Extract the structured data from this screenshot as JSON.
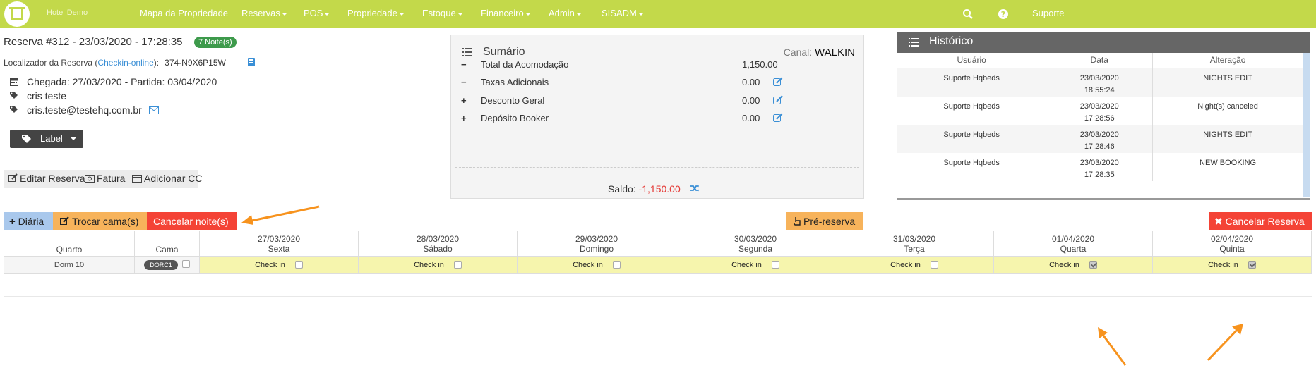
{
  "nav": {
    "brand": "Hotel Demo",
    "items": [
      "Mapa da Propriedade",
      "Reservas",
      "POS",
      "Propriedade",
      "Estoque",
      "Financeiro",
      "Admin",
      "SISADM"
    ],
    "support": "Suporte",
    "accent": "#c3d94a"
  },
  "reservation": {
    "title": "Reserva #312 - 23/03/2020 - 17:28:35",
    "nights_badge": "7 Noite(s)",
    "locator_prefix": "Localizador da Reserva (",
    "locator_link": "Checkin-online",
    "locator_suffix": "):",
    "locator_code": "374-N9X6P15W",
    "dates": "Chegada: 27/03/2020  -  Partida: 03/04/2020",
    "guest": "cris teste",
    "email": "cris.teste@testehq.com.br",
    "label_button": "Label"
  },
  "actions": {
    "edit": "Editar Reserva",
    "invoice": "Fatura",
    "add_cc": "Adicionar CC"
  },
  "summary": {
    "title": "Sumário",
    "canal_label": "Canal:",
    "canal_value": "WALKIN",
    "rows": [
      {
        "sign": "−",
        "label": "Total da Acomodação",
        "value": "1,150.00"
      },
      {
        "sign": "−",
        "label": "Taxas Adicionais",
        "value": "0.00"
      },
      {
        "sign": "+",
        "label": "Desconto Geral",
        "value": "0.00"
      },
      {
        "sign": "+",
        "label": "Depósito Booker",
        "value": "0.00"
      }
    ],
    "saldo_label": "Saldo:",
    "saldo_value": "-1,150.00"
  },
  "history": {
    "title": "Histórico",
    "columns": [
      "Usuário",
      "Data",
      "Alteração"
    ],
    "rows": [
      {
        "user": "Suporte Hqbeds",
        "date": "23/03/2020",
        "time": "18:55:24",
        "change": "NIGHTS EDIT"
      },
      {
        "user": "Suporte Hqbeds",
        "date": "23/03/2020",
        "time": "17:28:56",
        "change": "Night(s) canceled"
      },
      {
        "user": "Suporte Hqbeds",
        "date": "23/03/2020",
        "time": "17:28:46",
        "change": "NIGHTS EDIT"
      },
      {
        "user": "Suporte Hqbeds",
        "date": "23/03/2020",
        "time": "17:28:35",
        "change": "NEW BOOKING"
      }
    ]
  },
  "buttons": {
    "diaria": "Diária",
    "trocar": "Trocar cama(s)",
    "cancelar_noites": "Cancelar noite(s)",
    "pre_reserva": "Pré-reserva",
    "cancelar_reserva": "Cancelar Reserva"
  },
  "grid": {
    "room_header": "Quarto",
    "bed_header": "Cama",
    "days": [
      {
        "date": "27/03/2020",
        "weekday": "Sexta",
        "checked": false
      },
      {
        "date": "28/03/2020",
        "weekday": "Sábado",
        "checked": false
      },
      {
        "date": "29/03/2020",
        "weekday": "Domingo",
        "checked": false
      },
      {
        "date": "30/03/2020",
        "weekday": "Segunda",
        "checked": false
      },
      {
        "date": "31/03/2020",
        "weekday": "Terça",
        "checked": false
      },
      {
        "date": "01/04/2020",
        "weekday": "Quarta",
        "checked": true
      },
      {
        "date": "02/04/2020",
        "weekday": "Quinta",
        "checked": true
      }
    ],
    "room": "Dorm 10",
    "bed": "DORC1",
    "checkin_label": "Check in"
  }
}
